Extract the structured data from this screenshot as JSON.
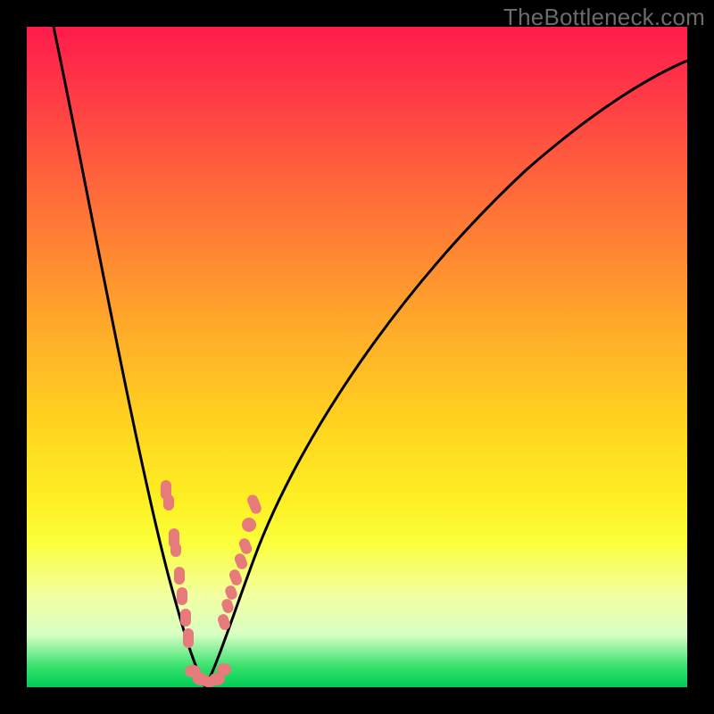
{
  "watermark": "TheBottleneck.com",
  "colors": {
    "frame": "#000000",
    "curve": "#000000",
    "markers": "#e77a7a",
    "gradient_stops": [
      "#ff1c4a",
      "#ff3348",
      "#ff5a3e",
      "#ff8333",
      "#ffb228",
      "#ffd31f",
      "#fef024",
      "#fbff3a",
      "#f3ffa0",
      "#d7ffc4",
      "#34e06a",
      "#00cc55"
    ]
  },
  "chart_data": {
    "type": "line",
    "title": "",
    "xlabel": "",
    "ylabel": "",
    "xlim": [
      0,
      1
    ],
    "ylim": [
      0,
      1
    ],
    "note": "x is normalized horizontal position (0=left,1=right); y is normalized height above baseline (0=bottom/green,1=top/red). The curve is a V-shaped bottleneck curve and dot markers cluster near the trough.",
    "series": [
      {
        "name": "curve-left",
        "x": [
          0.041,
          0.06,
          0.08,
          0.1,
          0.12,
          0.14,
          0.16,
          0.18,
          0.2,
          0.22,
          0.243,
          0.257,
          0.27
        ],
        "values": [
          1.0,
          0.88,
          0.77,
          0.66,
          0.555,
          0.455,
          0.36,
          0.27,
          0.19,
          0.12,
          0.045,
          0.018,
          0.0
        ]
      },
      {
        "name": "curve-right",
        "x": [
          0.27,
          0.297,
          0.324,
          0.365,
          0.419,
          0.486,
          0.568,
          0.662,
          0.757,
          0.851,
          0.946,
          1.0
        ],
        "values": [
          0.0,
          0.045,
          0.115,
          0.225,
          0.35,
          0.475,
          0.59,
          0.69,
          0.77,
          0.83,
          0.88,
          0.905
        ]
      },
      {
        "name": "markers-left",
        "kind": "scatter",
        "x": [
          0.209,
          0.213,
          0.222,
          0.224,
          0.23,
          0.234,
          0.239,
          0.243
        ],
        "values": [
          0.293,
          0.278,
          0.222,
          0.207,
          0.166,
          0.135,
          0.103,
          0.071
        ]
      },
      {
        "name": "markers-right",
        "kind": "scatter",
        "x": [
          0.297,
          0.302,
          0.307,
          0.315,
          0.322,
          0.329,
          0.336,
          0.343
        ],
        "values": [
          0.095,
          0.118,
          0.138,
          0.163,
          0.186,
          0.21,
          0.247,
          0.277
        ]
      },
      {
        "name": "markers-bottom",
        "kind": "scatter",
        "x": [
          0.251,
          0.26,
          0.27,
          0.28,
          0.288
        ],
        "values": [
          0.018,
          0.007,
          0.0,
          0.007,
          0.024
        ]
      }
    ]
  }
}
